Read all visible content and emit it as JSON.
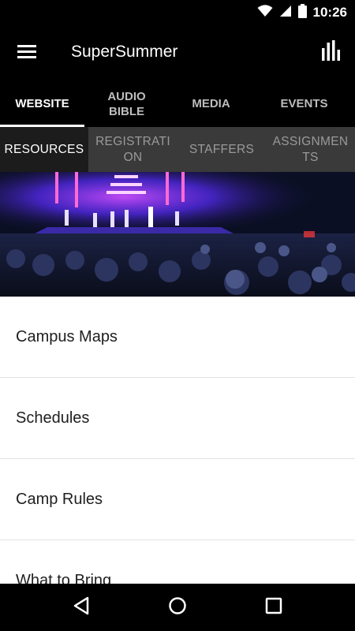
{
  "status_bar": {
    "time": "10:26",
    "icons": [
      "wifi-icon",
      "cellular-icon",
      "battery-icon"
    ]
  },
  "app_bar": {
    "title": "SuperSummer",
    "menu_icon": "hamburger-menu-icon",
    "action_icon": "bar-chart-icon"
  },
  "main_tabs": [
    {
      "label": "WEBSITE",
      "active": true
    },
    {
      "label": "AUDIO BIBLE",
      "active": false
    },
    {
      "label": "MEDIA",
      "active": false
    },
    {
      "label": "EVENTS",
      "active": false
    }
  ],
  "sub_tabs": [
    {
      "label": "RESOURCES",
      "active": true
    },
    {
      "label": "REGISTRATION",
      "active": false
    },
    {
      "label": "STAFFERS",
      "active": false
    },
    {
      "label": "ASSIGNMENTS",
      "active": false
    }
  ],
  "resources": [
    {
      "label": "Campus Maps"
    },
    {
      "label": "Schedules"
    },
    {
      "label": "Camp Rules"
    },
    {
      "label": "What to Bring"
    }
  ],
  "nav_bar": {
    "icons": [
      "back-icon",
      "home-icon",
      "recents-icon"
    ]
  },
  "colors": {
    "app_background": "#000000",
    "sub_tab_background": "#3a3a3a",
    "sub_tab_active": "#1c1c1c",
    "list_background": "#ffffff",
    "stage_light": "#7a2cff"
  }
}
